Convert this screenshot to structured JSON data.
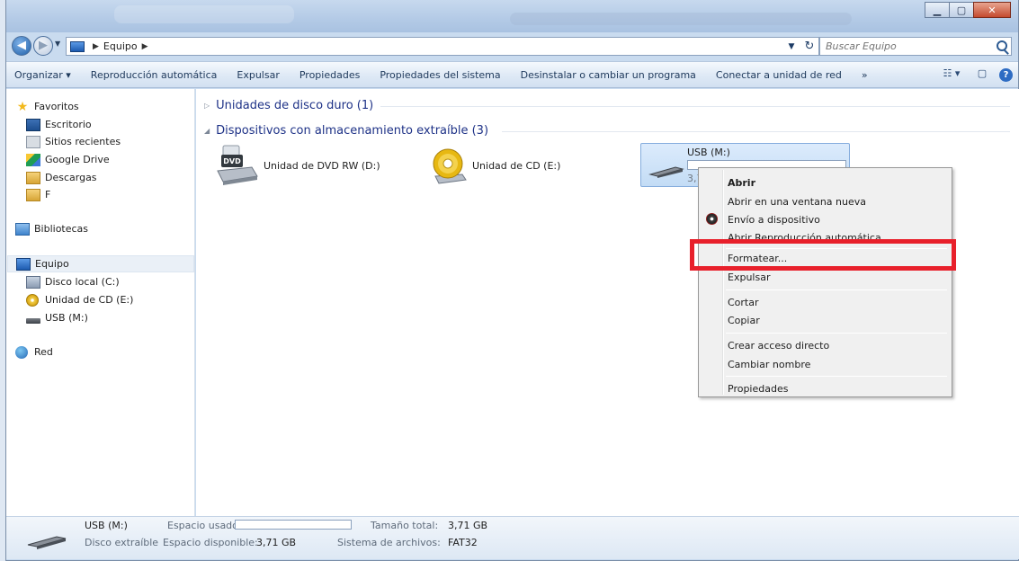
{
  "window": {
    "buttons": {
      "minimize": "▁",
      "maximize": "▢",
      "close": "✕"
    }
  },
  "nav": {
    "back_icon": "◀",
    "forward_icon": "▶",
    "dropdown_icon": "▼",
    "breadcrumb": [
      "Equipo"
    ],
    "search_placeholder": "Buscar Equipo",
    "refresh_icon": "↻",
    "dropdown_arrow": "▼"
  },
  "toolbar": {
    "items": [
      "Organizar ▾",
      "Reproducción automática",
      "Expulsar",
      "Propiedades",
      "Propiedades del sistema",
      "Desinstalar o cambiar un programa",
      "Conectar a unidad de red",
      "»"
    ],
    "view_icon": "☷ ▾",
    "pane_icon": "▢",
    "help_icon": "?"
  },
  "sidebar": {
    "favorites": {
      "label": "Favoritos",
      "items": [
        "Escritorio",
        "Sitios recientes",
        "Google Drive",
        "Descargas",
        "F"
      ]
    },
    "libraries": {
      "label": "Bibliotecas"
    },
    "computer": {
      "label": "Equipo",
      "items": [
        "Disco local (C:)",
        "Unidad de CD (E:)",
        "USB (M:)"
      ]
    },
    "network": {
      "label": "Red"
    }
  },
  "content": {
    "groups": [
      {
        "label": "Unidades de disco duro (1)",
        "collapsed": true
      },
      {
        "label": "Dispositivos con almacenamiento extraíble (3)",
        "collapsed": false
      }
    ],
    "collapsed_arrow": "▷",
    "expanded_arrow": "◢",
    "drives": {
      "dvd": {
        "label": "Unidad de DVD RW (D:)",
        "badge": "DVD"
      },
      "cd": {
        "label": "Unidad de CD (E:)"
      },
      "usb": {
        "label": "USB (M:)",
        "size": "3,71",
        "used_fraction": 0.0
      }
    }
  },
  "context_menu": {
    "items": [
      "Abrir",
      "Abrir en una ventana nueva",
      "Envío a dispositivo",
      "Abrir Reproducción automática...",
      "Formatear...",
      "Expulsar",
      "Cortar",
      "Copiar",
      "Crear acceso directo",
      "Cambiar nombre",
      "Propiedades"
    ]
  },
  "statusbar": {
    "name": "USB (M:)",
    "type": "Disco extraíble",
    "used_label": "Espacio usado:",
    "free_label": "Espacio disponible:",
    "free_value": "3,71 GB",
    "total_label": "Tamaño total:",
    "total_value": "3,71 GB",
    "fs_label": "Sistema de archivos:",
    "fs_value": "FAT32"
  },
  "colors": {
    "highlight": "#e8202b",
    "group_header": "#1e3287",
    "selection": "#c3dcf5"
  }
}
